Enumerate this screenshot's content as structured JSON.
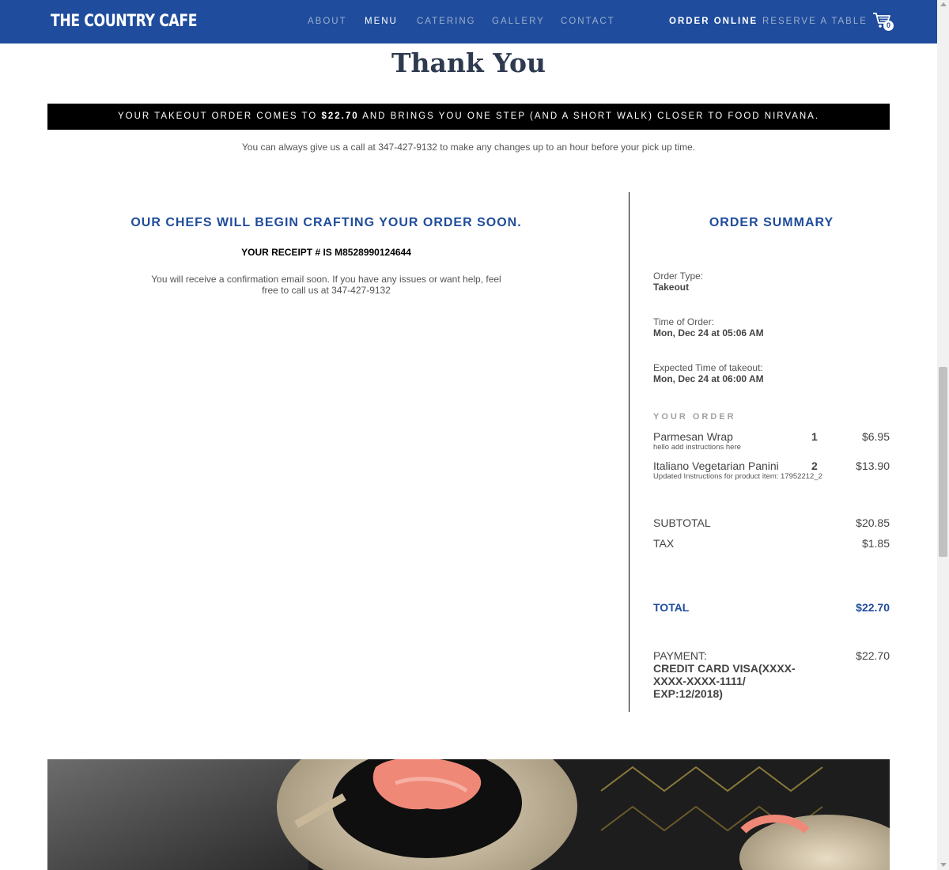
{
  "nav": {
    "logo": "THE COUNTRY CAFE",
    "links": [
      "ABOUT",
      "MENU",
      "CATERING",
      "GALLERY",
      "CONTACT"
    ],
    "order_online": "ORDER ONLINE",
    "reserve": "RESERVE A TABLE",
    "cart_count": "0"
  },
  "page": {
    "title": "Thank You",
    "banner_before": "YOUR TAKEOUT ORDER COMES TO ",
    "banner_amount": "$22.70",
    "banner_after": " AND BRINGS YOU ONE STEP (AND A SHORT WALK) CLOSER TO FOOD NIRVANA.",
    "call_note": "You can always give us a call at 347-427-9132 to make any changes up to an hour before your pick up time."
  },
  "confirmation": {
    "heading": "OUR CHEFS WILL BEGIN CRAFTING YOUR ORDER SOON.",
    "receipt": "YOUR RECEIPT # IS M8528990124644",
    "email_note": "You will receive a confirmation email soon. If you have any issues or want help, feel free to call us at 347-427-9132"
  },
  "summary": {
    "heading": "ORDER SUMMARY",
    "order_type_label": "Order Type:",
    "order_type": "Takeout",
    "time_label": "Time of Order:",
    "time": "Mon, Dec 24 at 05:06 AM",
    "expected_label": "Expected Time of takeout:",
    "expected": "Mon, Dec 24 at 06:00 AM",
    "your_order": "YOUR ORDER",
    "items": [
      {
        "name": "Parmesan Wrap",
        "note": "hello add instructions here",
        "qty": "1",
        "price": "$6.95"
      },
      {
        "name": "Italiano Vegetarian Panini",
        "note": "Updated Instructions for product item: 17952212_2",
        "qty": "2",
        "price": "$13.90"
      }
    ],
    "subtotal_label": "SUBTOTAL",
    "subtotal": "$20.85",
    "tax_label": "TAX",
    "tax": "$1.85",
    "total_label": "TOTAL",
    "total": "$22.70",
    "payment_label": "PAYMENT:",
    "payment_detail": "CREDIT CARD VISA(XXXX-XXXX-XXXX-1111/ EXP:12/2018)",
    "payment_amount": "$22.70"
  },
  "colors": {
    "brand_blue": "#1f4c9c",
    "banner_bg": "#000000",
    "nav_link": "#9bafd0"
  },
  "icons": {
    "cart": "shopping-cart-icon"
  }
}
